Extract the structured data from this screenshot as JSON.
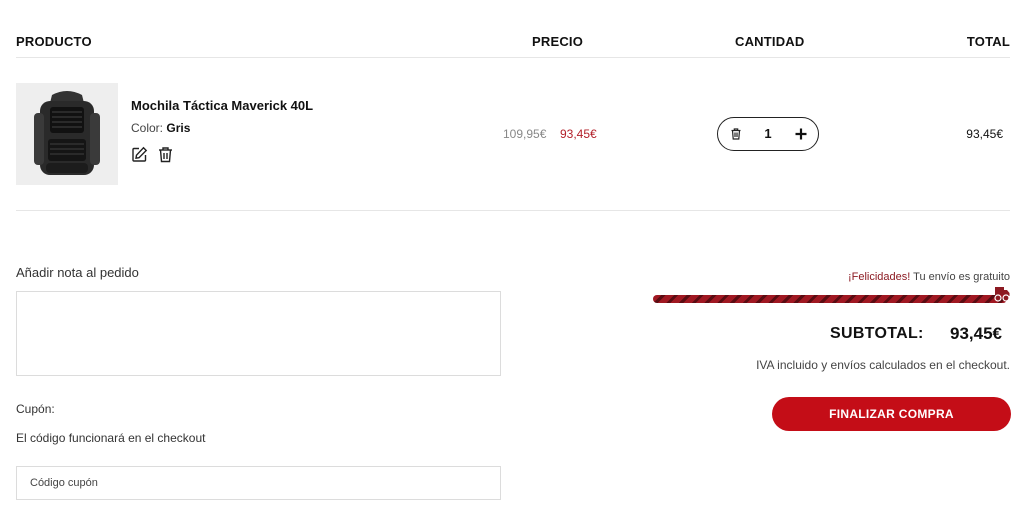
{
  "table_header": {
    "product": "PRODUCTO",
    "price": "PRECIO",
    "quantity": "CANTIDAD",
    "total": "TOTAL"
  },
  "item": {
    "name": "Mochila Táctica Maverick 40L",
    "color_label": "Color:",
    "color_value": "Gris",
    "price_original": "109,95€",
    "price_sale": "93,45€",
    "quantity": "1",
    "line_total": "93,45€",
    "image_icon": "backpack-image"
  },
  "note": {
    "label": "Añadir nota al pedido",
    "value": ""
  },
  "coupon": {
    "label": "Cupón:",
    "info": "El código funcionará en el checkout",
    "placeholder": "Código cupón",
    "value": ""
  },
  "shipping": {
    "highlight": "¡Felicidades!",
    "message": " Tu envío es gratuito",
    "progress_percent": 100
  },
  "summary": {
    "subtotal_label": "SUBTOTAL:",
    "subtotal_value": "93,45€",
    "tax_note": "IVA incluido y envíos calculados en el checkout.",
    "checkout_label": "FINALIZAR COMPRA"
  },
  "colors": {
    "accent": "#c40d17",
    "sale_price": "#b3202a",
    "highlight": "#8c1a22"
  },
  "icons": {
    "edit": "edit-icon",
    "delete": "trash-icon",
    "plus": "plus-icon",
    "shipping": "truck-icon"
  }
}
